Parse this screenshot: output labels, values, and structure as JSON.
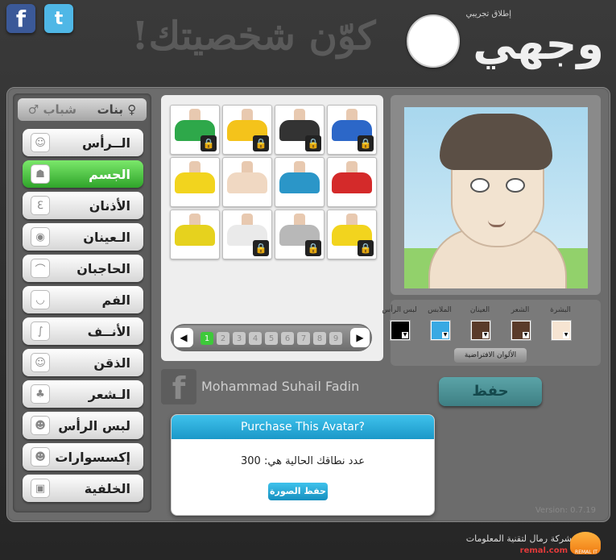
{
  "header": {
    "facebook_glyph": "f",
    "twitter_glyph": "t",
    "slogan": "كوّن شخصيتك!",
    "logo_text": "وجهي",
    "logo_subtitle": "إطلاق تجريبي"
  },
  "gender": {
    "girls": "♀ بنات",
    "boys": "شباب ♂"
  },
  "nav": [
    {
      "label": "الــرأس",
      "icon": "☺",
      "active": false
    },
    {
      "label": "الجسم",
      "icon": "☗",
      "active": true
    },
    {
      "label": "الأذنان",
      "icon": "ℇ",
      "active": false
    },
    {
      "label": "الـعينان",
      "icon": "◉",
      "active": false
    },
    {
      "label": "الحاجبان",
      "icon": "⌒",
      "active": false
    },
    {
      "label": "الفم",
      "icon": "◡",
      "active": false
    },
    {
      "label": "الأنــف",
      "icon": "∫",
      "active": false
    },
    {
      "label": "الذقن",
      "icon": "☺",
      "active": false
    },
    {
      "label": "الـشعر",
      "icon": "♣",
      "active": false
    },
    {
      "label": "لبس الرأس",
      "icon": "☻",
      "active": false
    },
    {
      "label": "إكسسوارات",
      "icon": "☻",
      "active": false
    },
    {
      "label": "الخلفية",
      "icon": "▣",
      "active": false
    }
  ],
  "items": [
    {
      "color": "#2c67c8",
      "locked": true
    },
    {
      "color": "#333333",
      "locked": true
    },
    {
      "color": "#f4c31b",
      "locked": true
    },
    {
      "color": "#2ea84a",
      "locked": true
    },
    {
      "color": "#d42a2a",
      "locked": false
    },
    {
      "color": "#2b96c8",
      "locked": false
    },
    {
      "color": "#f0d8c2",
      "locked": false
    },
    {
      "color": "#f2d41e",
      "locked": false
    },
    {
      "color": "#f2d41e",
      "locked": true
    },
    {
      "color": "#b8b8b8",
      "locked": true
    },
    {
      "color": "#eaeaea",
      "locked": true
    },
    {
      "color": "#e6d21e",
      "locked": false
    }
  ],
  "pager": {
    "pages": [
      "1",
      "2",
      "3",
      "4",
      "5",
      "6",
      "7",
      "8",
      "9"
    ],
    "current": "1",
    "prev": "◀",
    "next": "▶"
  },
  "color_labels": [
    "البشرة",
    "الشعر",
    "العينان",
    "الملابس",
    "لبس الرأس"
  ],
  "color_values": [
    "#f6e4d2",
    "#5a3b2a",
    "#5a3b2a",
    "#39a9e3",
    "#000000"
  ],
  "defaults_label": "الألوان الافتراضية",
  "save_label": "حفظ",
  "facebook_user": {
    "glyph": "f",
    "name": "Mohammad Suhail Fadin"
  },
  "dialog": {
    "title": "Purchase This Avatar?",
    "message": "عدد نطاقك الحالية هي: 300",
    "button": "حفظ الصورة"
  },
  "version": "Version: 0.7.19",
  "footer": {
    "company": "شركة رمال لتقنية المعلومات",
    "link": "remal.com",
    "logo_text": "REMAL IT"
  }
}
